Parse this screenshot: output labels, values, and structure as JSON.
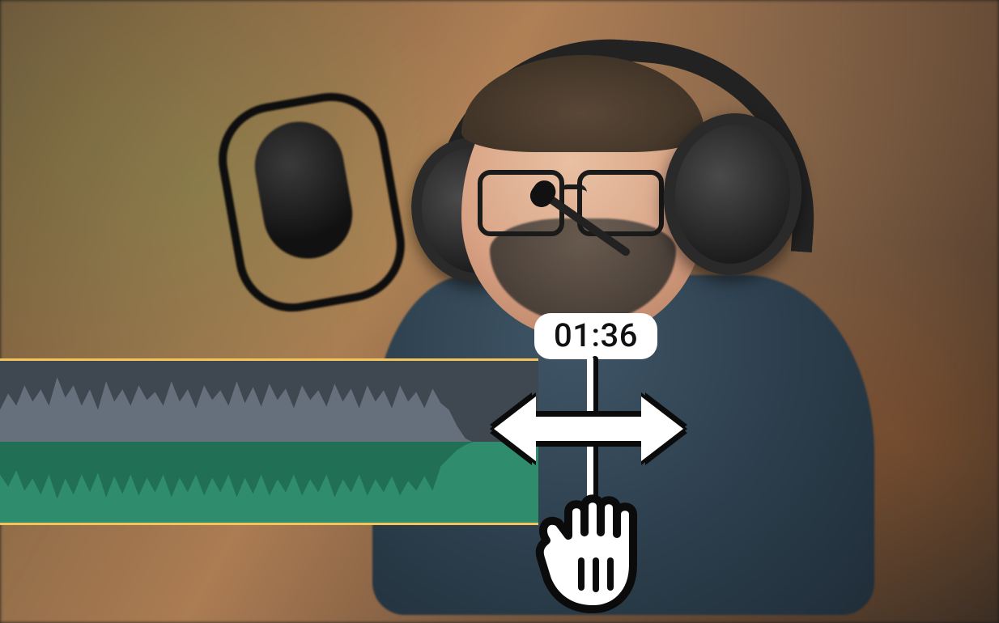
{
  "timeline": {
    "timestamp": "01:36"
  }
}
